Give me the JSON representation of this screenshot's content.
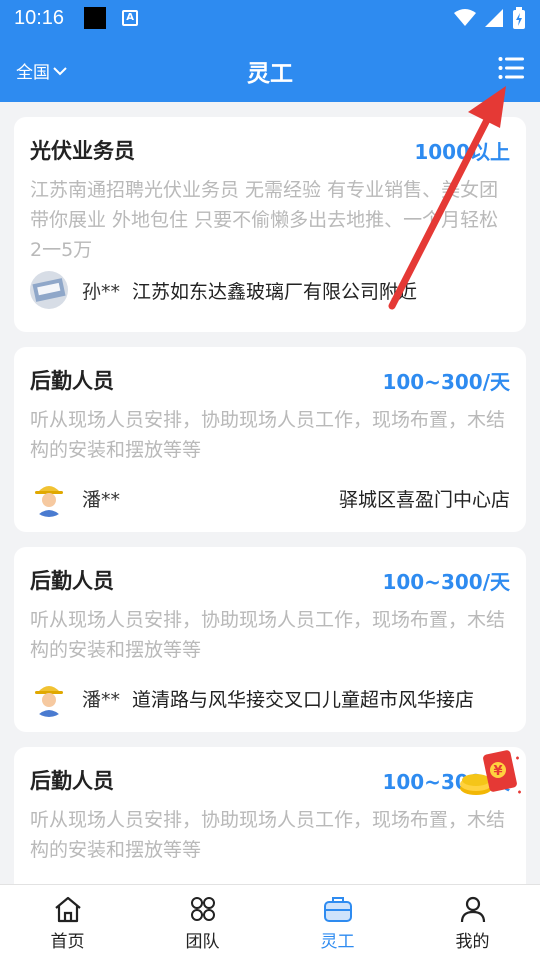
{
  "status_bar": {
    "time": "10:16",
    "badge_letter": "A"
  },
  "app_bar": {
    "region": "全国",
    "title": "灵工"
  },
  "jobs": [
    {
      "name": "光伏业务员",
      "salary": "1000以上",
      "desc": "江苏南通招聘光伏业务员 无需经验 有专业销售、美女团带你展业 外地包住 只要不偷懒多出去地推、一个月轻松2一5万",
      "poster": "孙**",
      "location": "江苏如东达鑫玻璃厂有限公司附近"
    },
    {
      "name": "后勤人员",
      "salary": "100~300/天",
      "desc": "听从现场人员安排，协助现场人员工作，现场布置，木结构的安装和摆放等等",
      "poster": "潘**",
      "location": "驿城区喜盈门中心店"
    },
    {
      "name": "后勤人员",
      "salary": "100~300/天",
      "desc": "听从现场人员安排，协助现场人员工作，现场布置，木结构的安装和摆放等等",
      "poster": "潘**",
      "location": "道清路与风华接交叉口儿童超市风华接店"
    },
    {
      "name": "后勤人员",
      "salary": "100~300/天",
      "desc": "听从现场人员安排，协助现场人员工作，现场布置，木结构的安装和摆放等等",
      "poster": "",
      "location": ""
    }
  ],
  "tabs": [
    {
      "label": "首页",
      "icon": "home-icon"
    },
    {
      "label": "团队",
      "icon": "team-icon"
    },
    {
      "label": "灵工",
      "icon": "briefcase-icon"
    },
    {
      "label": "我的",
      "icon": "person-icon"
    }
  ],
  "colors": {
    "accent": "#2e8bf0",
    "annotation": "#e53935",
    "muted_text": "#b9b9b9"
  }
}
